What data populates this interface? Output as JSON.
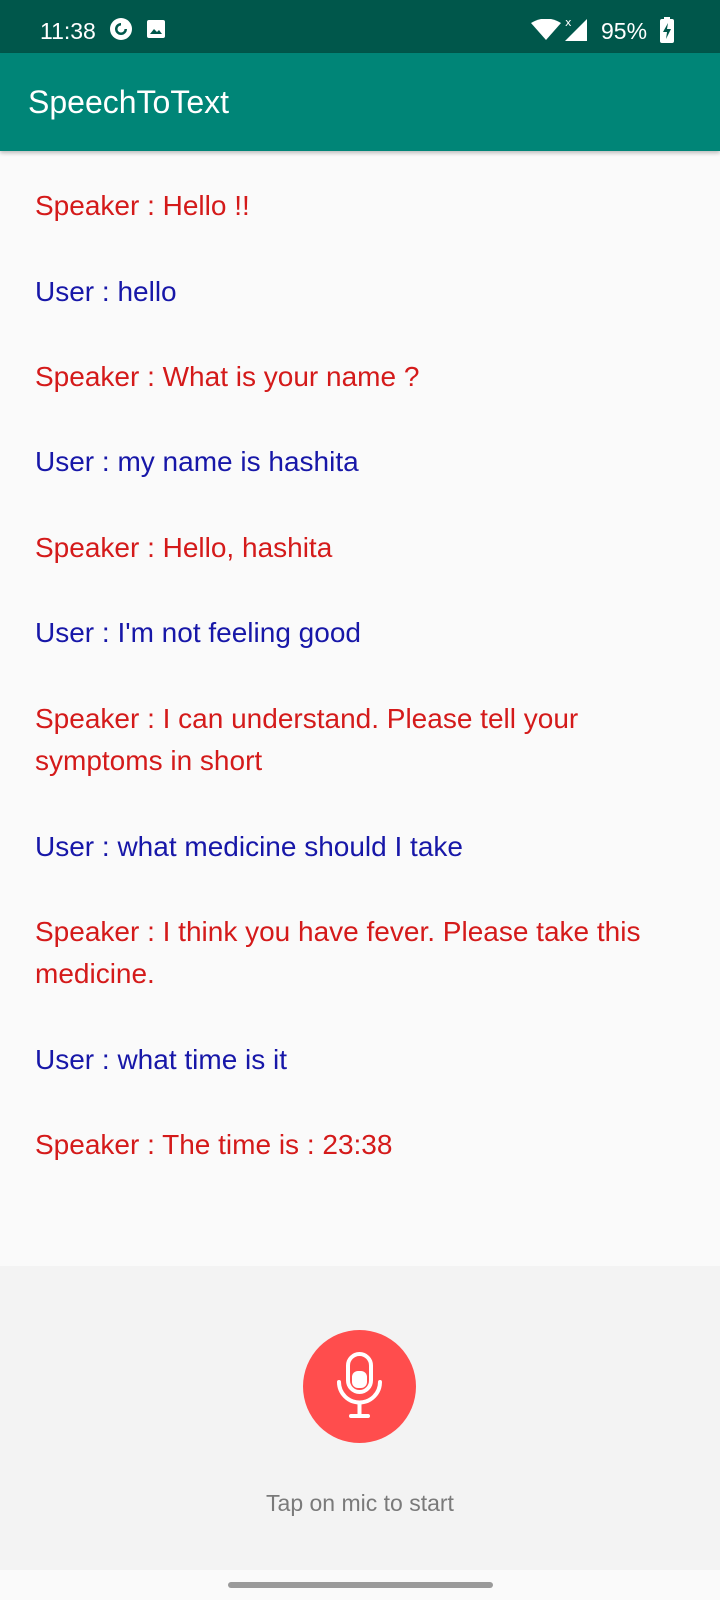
{
  "status_bar": {
    "time": "11:38",
    "battery_percent": "95%",
    "icons": [
      "pocketcasts-icon",
      "image-icon",
      "wifi-icon",
      "cell-signal-icon",
      "battery-charging-icon"
    ]
  },
  "app_bar": {
    "title": "SpeechToText"
  },
  "colors": {
    "status_bar": "#00574b",
    "app_bar": "#008577",
    "speaker_text": "#d41a1a",
    "user_text": "#1717a8",
    "mic_button": "#ff4d4d"
  },
  "conversation": [
    {
      "role": "speaker",
      "text": "Speaker : Hello !!"
    },
    {
      "role": "user",
      "text": "User : hello"
    },
    {
      "role": "speaker",
      "text": "Speaker : What is your name ?"
    },
    {
      "role": "user",
      "text": "User : my name is hashita"
    },
    {
      "role": "speaker",
      "text": "Speaker : Hello, hashita"
    },
    {
      "role": "user",
      "text": "User : I'm not feeling good"
    },
    {
      "role": "speaker",
      "text": "Speaker : I can understand. Please tell your symptoms in short"
    },
    {
      "role": "user",
      "text": "User : what medicine should I take"
    },
    {
      "role": "speaker",
      "text": "Speaker : I think you have fever. Please take this medicine."
    },
    {
      "role": "user",
      "text": "User : what time is it"
    },
    {
      "role": "speaker",
      "text": "Speaker : The time is : 23:38"
    }
  ],
  "mic": {
    "hint": "Tap on mic to start",
    "icon": "microphone-icon"
  }
}
